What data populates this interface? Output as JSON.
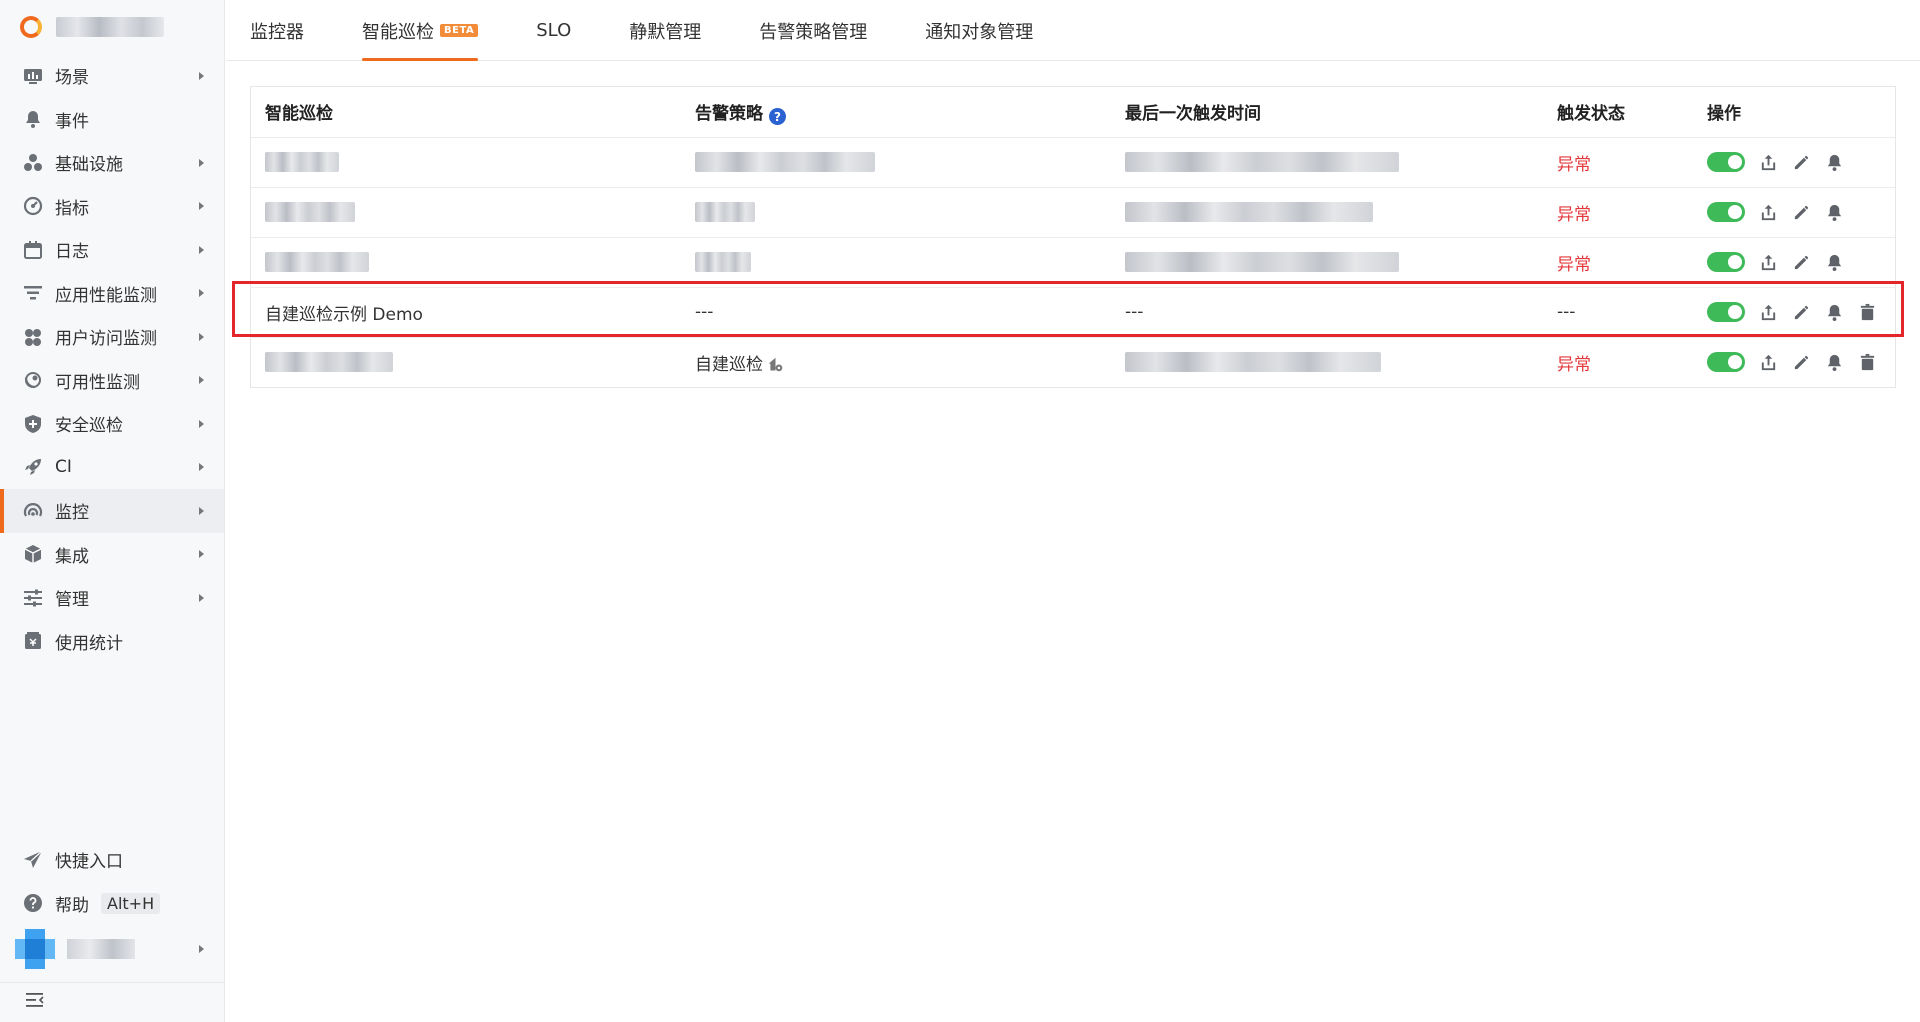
{
  "sidebar": {
    "items": [
      {
        "label": "场景",
        "icon": "dashboard-icon",
        "caret": true
      },
      {
        "label": "事件",
        "icon": "bell-icon",
        "caret": false
      },
      {
        "label": "基础设施",
        "icon": "cluster-icon",
        "caret": true
      },
      {
        "label": "指标",
        "icon": "gauge-icon",
        "caret": true
      },
      {
        "label": "日志",
        "icon": "calendar-icon",
        "caret": true
      },
      {
        "label": "应用性能监测",
        "icon": "filter-icon",
        "caret": true
      },
      {
        "label": "用户访问监测",
        "icon": "users-icon",
        "caret": true
      },
      {
        "label": "可用性监测",
        "icon": "satellite-icon",
        "caret": true
      },
      {
        "label": "安全巡检",
        "icon": "shield-icon",
        "caret": true
      },
      {
        "label": "CI",
        "icon": "rocket-icon",
        "caret": true
      },
      {
        "label": "监控",
        "icon": "radar-icon",
        "caret": true,
        "active": true
      },
      {
        "label": "集成",
        "icon": "cube-icon",
        "caret": true
      },
      {
        "label": "管理",
        "icon": "sliders-icon",
        "caret": true
      },
      {
        "label": "使用统计",
        "icon": "billing-icon",
        "caret": false
      }
    ],
    "quick_entry": "快捷入口",
    "help": "帮助",
    "help_shortcut": "Alt+H"
  },
  "tabs": [
    {
      "label": "监控器",
      "active": false
    },
    {
      "label": "智能巡检",
      "active": true,
      "badge": "BETA"
    },
    {
      "label": "SLO",
      "active": false
    },
    {
      "label": "静默管理",
      "active": false
    },
    {
      "label": "告警策略管理",
      "active": false
    },
    {
      "label": "通知对象管理",
      "active": false
    }
  ],
  "table": {
    "columns": [
      "智能巡检",
      "告警策略",
      "最后一次触发时间",
      "触发状态",
      "操作"
    ],
    "rows": [
      {
        "name": "",
        "policy": "",
        "last_time": "",
        "status": "异常",
        "blurred": true,
        "deletable": false
      },
      {
        "name": "",
        "policy": "",
        "last_time": "",
        "status": "异常",
        "blurred": true,
        "deletable": false
      },
      {
        "name": "",
        "policy": "",
        "last_time": "",
        "status": "异常",
        "blurred": true,
        "deletable": false
      },
      {
        "name": "自建巡检示例 Demo",
        "policy": "---",
        "last_time": "---",
        "status": "---",
        "blurred": false,
        "deletable": true
      },
      {
        "name": "",
        "policy": "自建巡检",
        "last_time": "",
        "status": "异常",
        "blurred": true,
        "deletable": true
      }
    ]
  },
  "colors": {
    "accent": "#f06a1d",
    "toggle_on": "#3fba59",
    "abnormal": "#e4393c",
    "highlight": "#e4262b"
  }
}
